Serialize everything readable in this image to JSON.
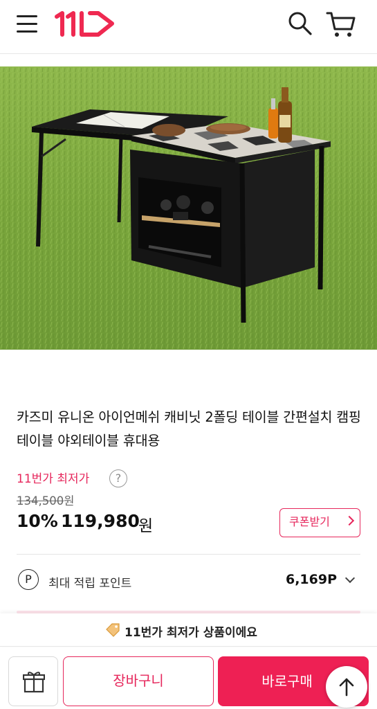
{
  "header": {
    "menu_icon": "hamburger-icon",
    "logo_text": "11",
    "logo_icon": "11st-logo",
    "search_icon": "search-icon",
    "cart_icon": "cart-icon"
  },
  "product": {
    "image_alt": "camping table with mesh cabinet on grass",
    "title": "카즈미 유니온 아이언메쉬 캐비닛 2폴딩 테이블 간편설치 캠핑테이블 야외테이블 휴대용",
    "lowest_label": "11번가 최저가",
    "help_icon_text": "?",
    "original_price": "134,500",
    "original_price_unit": "원",
    "discount": "10%",
    "price": "119,980",
    "price_unit": "원",
    "coupon_label": "쿠폰받기"
  },
  "points": {
    "icon_text": "P",
    "label": "최대 적립 포인트",
    "value": "6,169P"
  },
  "banner": {
    "text": "11번가 최저가 상품이에요"
  },
  "bottom_bar": {
    "cart_label": "장바구니",
    "buy_label": "바로구매"
  },
  "colors": {
    "brand": "#e6265b",
    "buy_button": "#ee2054"
  }
}
